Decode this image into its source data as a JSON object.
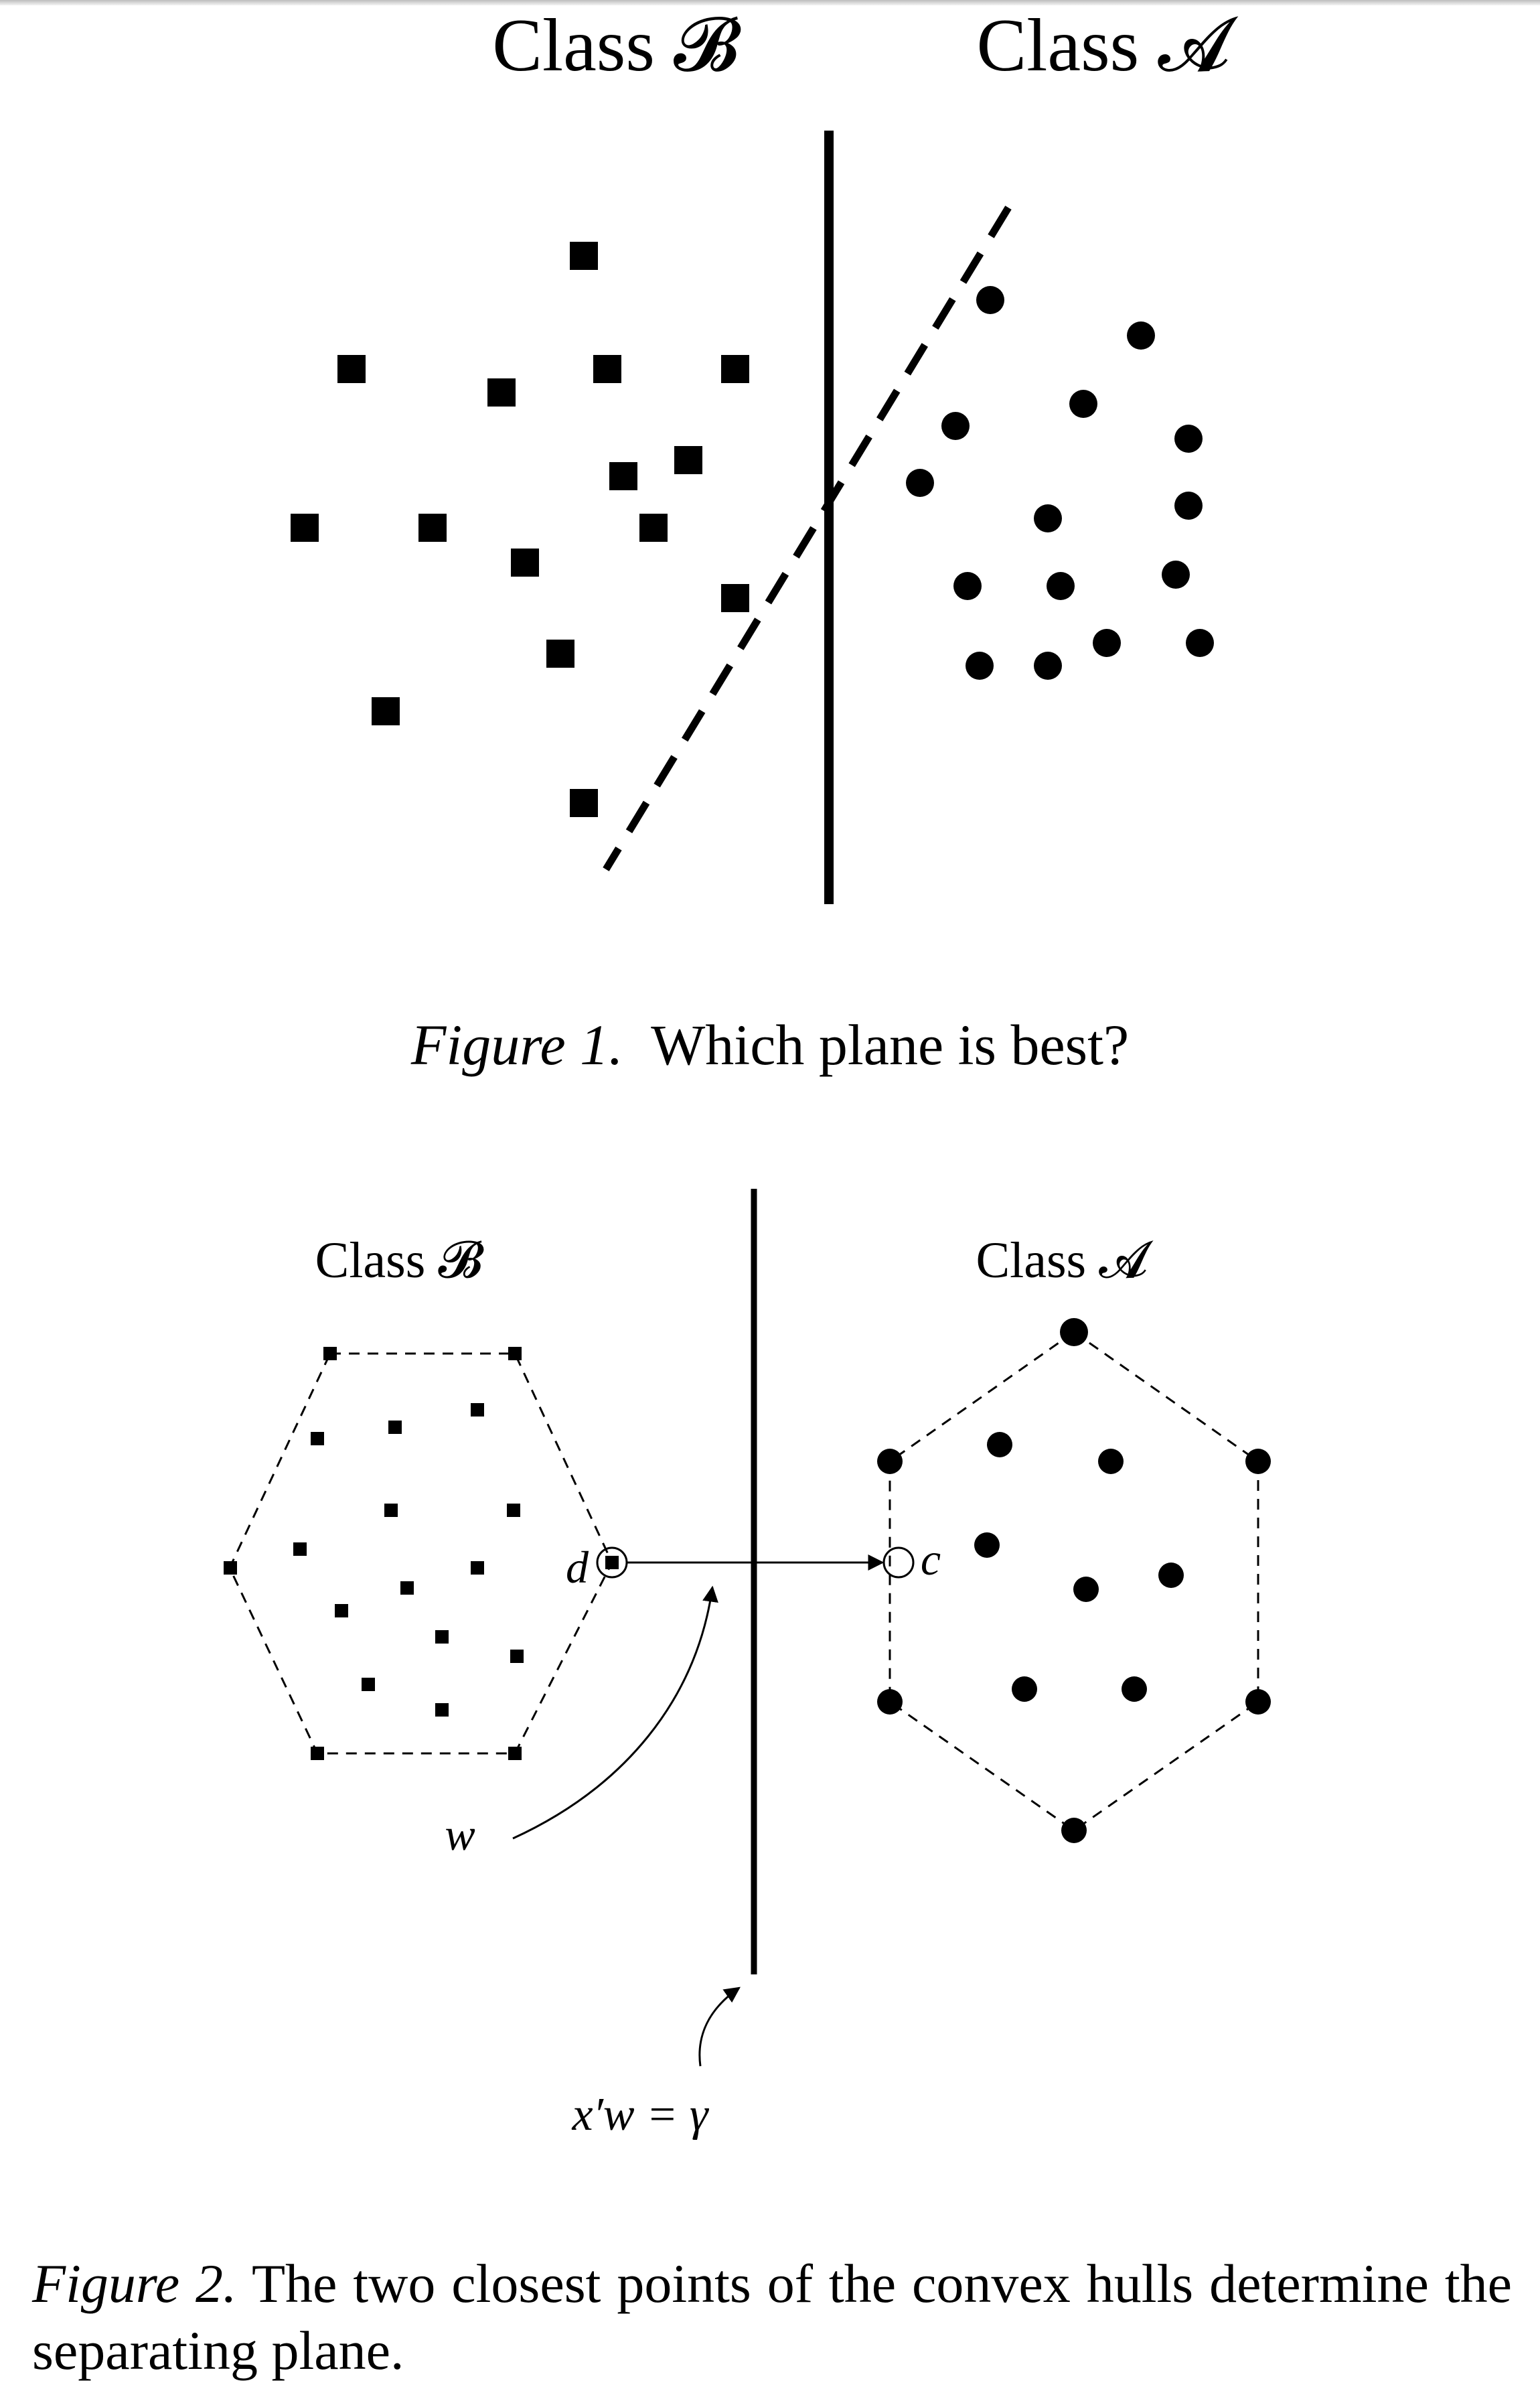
{
  "figure1": {
    "class_b_label": "Class 𝓑",
    "class_a_label": "Class 𝓐",
    "caption_label": "Figure 1.",
    "caption_text": "Which plane is best?"
  },
  "figure2": {
    "class_b_label": "Class 𝓑",
    "class_a_label": "Class 𝓐",
    "point_d_label": "d",
    "point_c_label": "c",
    "w_label": "w",
    "plane_label": "x′w = γ",
    "caption_label": "Figure 2.",
    "caption_text": "The two closest points of the convex hulls determine the separating plane."
  },
  "colors": {
    "ink": "#000000",
    "background": "#ffffff"
  }
}
